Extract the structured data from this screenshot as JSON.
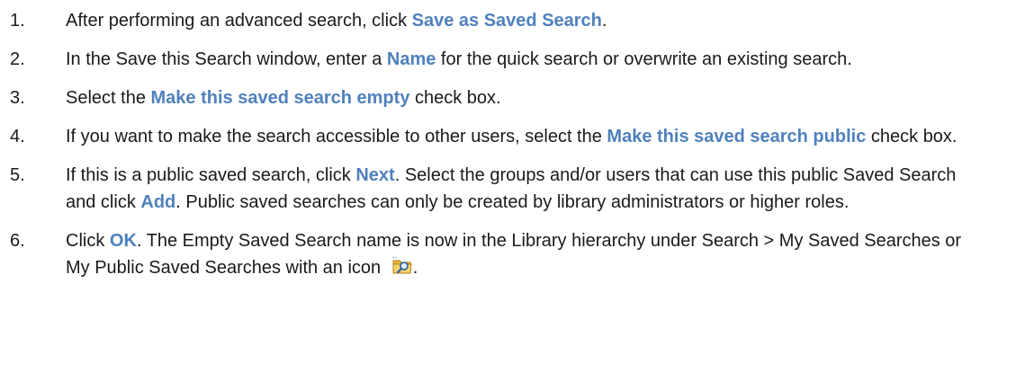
{
  "steps": [
    {
      "number": "1.",
      "segments": [
        {
          "text": "After performing an advanced search, click "
        },
        {
          "text": "Save as Saved Search",
          "ui": true
        },
        {
          "text": "."
        }
      ]
    },
    {
      "number": "2.",
      "segments": [
        {
          "text": "In the Save this Search window, enter a "
        },
        {
          "text": "Name",
          "ui": true
        },
        {
          "text": " for the quick search or overwrite an existing search."
        }
      ]
    },
    {
      "number": "3.",
      "segments": [
        {
          "text": "Select the "
        },
        {
          "text": "Make this saved search empty",
          "ui": true
        },
        {
          "text": " check box."
        }
      ]
    },
    {
      "number": "4.",
      "segments": [
        {
          "text": "If you want to make the search accessible to other users, select the "
        },
        {
          "text": "Make this saved search public",
          "ui": true
        },
        {
          "text": " check box."
        }
      ]
    },
    {
      "number": "5.",
      "segments": [
        {
          "text": "If this is a public saved search, click "
        },
        {
          "text": "Next",
          "ui": true
        },
        {
          "text": ". Select the groups and/or users that can use this public Saved Search and click "
        },
        {
          "text": "Add",
          "ui": true
        },
        {
          "text": ". Public saved searches can only be created by library administrators or higher roles."
        }
      ]
    },
    {
      "number": "6.",
      "segments": [
        {
          "text": "Click "
        },
        {
          "text": "OK",
          "ui": true
        },
        {
          "text": ". The Empty Saved Search name is now in the Library hierarchy under Search > My Saved Searches or My Public Saved Searches with an icon "
        }
      ],
      "icon": "saved-search-folder-icon",
      "trailing": "."
    }
  ],
  "colors": {
    "ui_emphasis": "#4f81bd",
    "body_text": "#1a1a1a"
  }
}
